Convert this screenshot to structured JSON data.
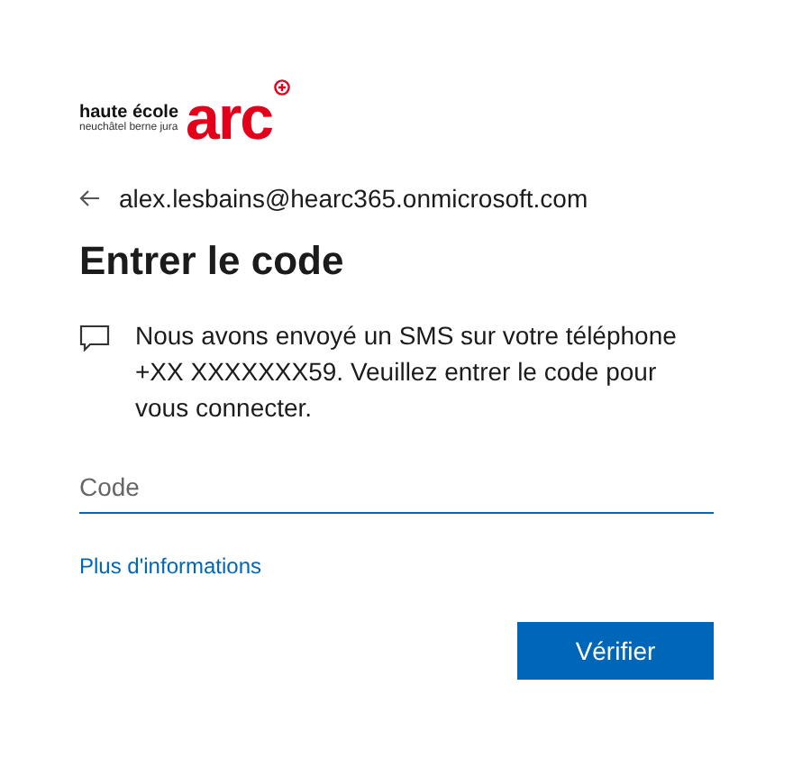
{
  "logo": {
    "line1": "haute école",
    "line2": "neuchâtel berne jura",
    "mark": "arc"
  },
  "identity": {
    "email": "alex.lesbains@hearc365.onmicrosoft.com"
  },
  "title": "Entrer le code",
  "message": "Nous avons envoyé un SMS sur votre téléphone +XX XXXXXXX59. Veuillez entrer le code pour vous connecter.",
  "code_field": {
    "placeholder": "Code"
  },
  "link": "Plus d'informations",
  "buttons": [
    "Vérifier"
  ]
}
